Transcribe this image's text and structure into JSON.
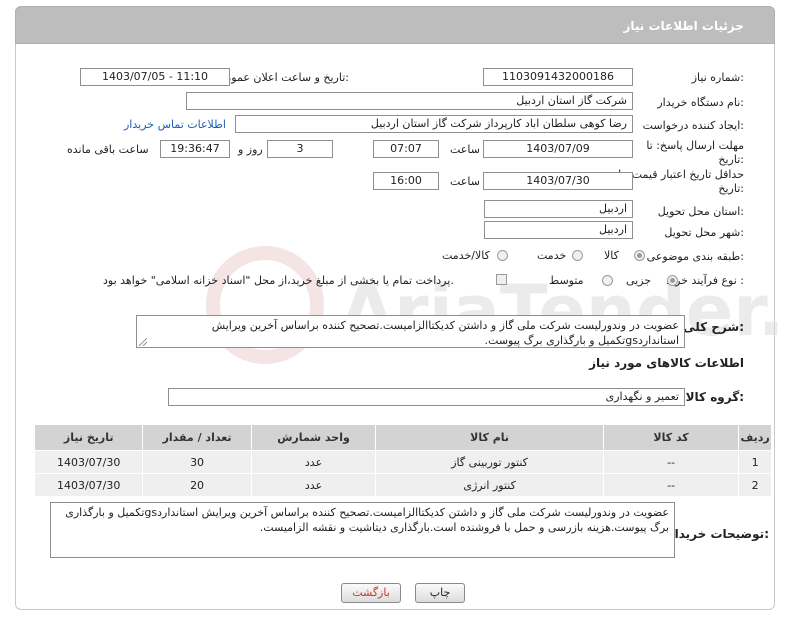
{
  "page": {
    "header_title": "جزئیات اطلاعات نیاز"
  },
  "form": {
    "need_number_label": "شماره نیاز:",
    "need_number": "1103091432000186",
    "announce_label": "تاریخ و ساعت اعلان عمومی:",
    "announce_value": "1403/07/05 - 11:10",
    "buyer_org_label": "نام دستگاه خریدار:",
    "buyer_org": "شرکت گاز استان اردبیل",
    "creator_label": "ایجاد کننده درخواست:",
    "creator": "رضا کوهی سلطان اباد کارپرداز شرکت گاز استان اردبیل",
    "contact_link": "اطلاعات تماس خریدار",
    "deadline_label_1": "مهلت ارسال پاسخ: تا",
    "deadline_label_2": "تاریخ:",
    "deadline_date": "1403/07/09",
    "time_label": "ساعت",
    "deadline_time": "07:07",
    "days_value": "3",
    "days_label": "روز و",
    "remaining_time": "19:36:47",
    "remaining_label": "ساعت باقی مانده",
    "validity_label_1": "حداقل تاریخ اعتبار قیمت: تا",
    "validity_label_2": "تاریخ:",
    "validity_date": "1403/07/30",
    "validity_time_label": "ساعت",
    "validity_time": "16:00",
    "province_label": "استان محل تحویل:",
    "province": "اردبیل",
    "city_label": "شهر محل تحویل:",
    "city": "اردبیل",
    "category_label": "طبقه بندی موضوعی:",
    "category_options": [
      "کالا",
      "خدمت",
      "کالا/خدمت"
    ],
    "process_label": "نوع فرآیند خرید :",
    "process_options": [
      "جزیی",
      "متوسط"
    ],
    "payment_text": "پرداخت تمام یا بخشی از مبلغ خرید،از محل \"اسناد خزانه اسلامی\" خواهد بود.",
    "summary_label": "شرح کلی نیاز:",
    "summary_text": "عضویت در وندورلیست شرکت ملی گاز و داشتن کدیکتاالزامیست.تصحیح کننده براساس آخرین ویرایش استانداردgsتکمیل و بارگذاری برگ پیوست."
  },
  "goods": {
    "section_title": "اطلاعات کالاهای مورد نیاز",
    "group_label": "گروه کالا:",
    "group_value": "تعمیر و نگهداری",
    "columns": [
      "ردیف",
      "کد کالا",
      "نام کالا",
      "واحد شمارش",
      "تعداد / مقدار",
      "تاریخ نیاز"
    ],
    "rows": [
      [
        "1",
        "--",
        "کنتور توربینی گاز",
        "عدد",
        "30",
        "1403/07/30"
      ],
      [
        "2",
        "--",
        "کنتور انرژی",
        "عدد",
        "20",
        "1403/07/30"
      ]
    ]
  },
  "buyer_notes": {
    "label": "توضیحات خریدار:",
    "text": "عضویت در وندورلیست شرکت ملی گاز و داشتن کدیکتاالزامیست.تصحیح کننده براساس آخرین ویرایش استانداردgsتکمیل و بارگذاری برگ پیوست.هزینه بازرسی و حمل با فروشنده است.بارگذاری دیتاشیت و نقشه الزامیست."
  },
  "buttons": {
    "print": "چاپ",
    "back": "بازگشت"
  },
  "watermark": "AriaTender.neT",
  "colors": {
    "header_bg": "#bdbdbd",
    "link": "#1a5fb4",
    "back_button_text": "#c0392b"
  }
}
